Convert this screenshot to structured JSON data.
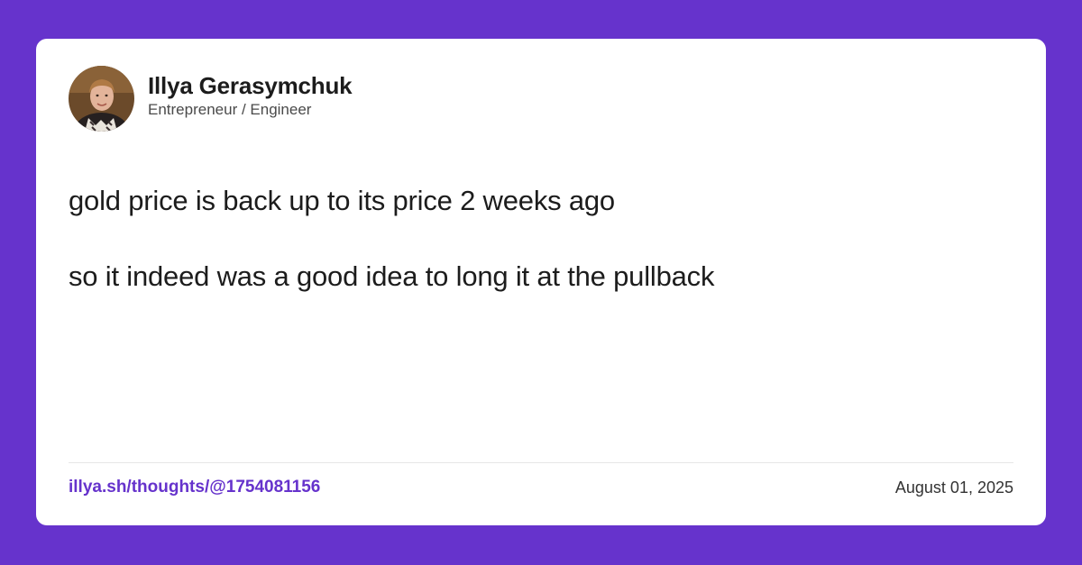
{
  "theme": {
    "background_color": "#6633cc",
    "card_color": "#ffffff",
    "accent_color": "#6633cc",
    "text_color": "#1c1c1c"
  },
  "author": {
    "name": "Illya Gerasymchuk",
    "role": "Entrepreneur / Engineer",
    "avatar_icon": "user-avatar-photo"
  },
  "post": {
    "lines": [
      "gold price is back up to its price 2 weeks ago",
      "so it indeed was a good idea to long it at the pullback"
    ]
  },
  "footer": {
    "link": "illya.sh/thoughts/@1754081156",
    "date": "August 01, 2025"
  }
}
